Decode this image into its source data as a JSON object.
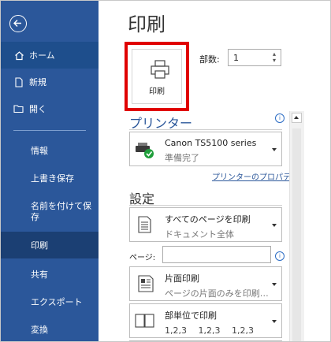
{
  "window": {
    "title": "印刷"
  },
  "sidebar": {
    "items": [
      {
        "label": "ホーム",
        "icon": "home-icon"
      },
      {
        "label": "新規",
        "icon": "new-document-icon"
      },
      {
        "label": "開く",
        "icon": "open-folder-icon"
      },
      {
        "label": "情報"
      },
      {
        "label": "上書き保存"
      },
      {
        "label": "名前を付けて保存"
      },
      {
        "label": "印刷"
      },
      {
        "label": "共有"
      },
      {
        "label": "エクスポート"
      },
      {
        "label": "変換"
      }
    ]
  },
  "print": {
    "button_label": "印刷",
    "copies_label": "部数:",
    "copies_value": "1"
  },
  "printer": {
    "section_title": "プリンター",
    "name": "Canon TS5100 series",
    "status": "準備完了",
    "properties_link": "プリンターのプロパティ"
  },
  "settings": {
    "section_title": "設定",
    "range_title": "すべてのページを印刷",
    "range_sub": "ドキュメント全体",
    "pages_label": "ページ:",
    "sides_title": "片面印刷",
    "sides_sub": "ページの片面のみを印刷…",
    "collate_title": "部単位で印刷",
    "collate_sub": "1,2,3　 1,2,3　 1,2,3"
  },
  "colors": {
    "sidebar": "#2b579a",
    "highlight": "#e00000",
    "accent": "#2b579a"
  }
}
